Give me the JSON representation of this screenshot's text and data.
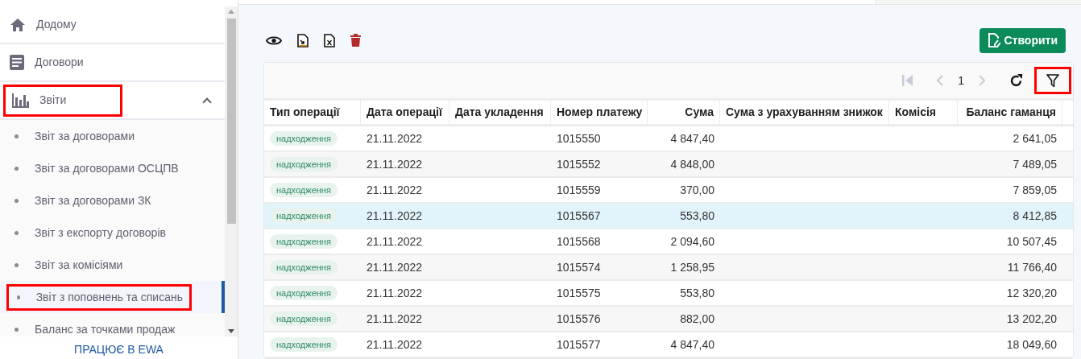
{
  "sidebar": {
    "items": [
      {
        "label": "Додому",
        "selected": false,
        "highlighted": false
      },
      {
        "label": "Договори",
        "selected": false,
        "highlighted": false
      },
      {
        "label": "Звіти",
        "selected": false,
        "highlighted": true,
        "expanded": true,
        "children": [
          {
            "label": "Звіт за договорами",
            "selected": false,
            "highlighted": false
          },
          {
            "label": "Звіт за договорами ОСЦПВ",
            "selected": false,
            "highlighted": false
          },
          {
            "label": "Звіт за договорами ЗК",
            "selected": false,
            "highlighted": false
          },
          {
            "label": "Звіт з експорту договорів",
            "selected": false,
            "highlighted": false
          },
          {
            "label": "Звіт за комісіями",
            "selected": false,
            "highlighted": false
          },
          {
            "label": "Звіт з поповнень та списань",
            "selected": true,
            "highlighted": true
          },
          {
            "label": "Баланс за точками продаж",
            "selected": false,
            "highlighted": false
          }
        ]
      }
    ],
    "footer": "ПРАЦЮЄ В EWA"
  },
  "toolbar": {
    "create_button": "Створити"
  },
  "pagination": {
    "page": "1",
    "filter_highlighted": true
  },
  "table": {
    "columns": [
      "Тип операції",
      "Дата операції",
      "Дата укладення",
      "Номер платежу",
      "Сума",
      "Сума з урахуванням знижок",
      "Комісія",
      "Баланс гаманця"
    ],
    "rows": [
      {
        "type": "надходження",
        "date": "21.11.2022",
        "number": "1015550",
        "sum": "4 847,40",
        "balance": "2 641,05",
        "selected": false
      },
      {
        "type": "надходження",
        "date": "21.11.2022",
        "number": "1015552",
        "sum": "4 848,00",
        "balance": "7 489,05",
        "selected": false
      },
      {
        "type": "надходження",
        "date": "21.11.2022",
        "number": "1015559",
        "sum": "370,00",
        "balance": "7 859,05",
        "selected": false
      },
      {
        "type": "надходження",
        "date": "21.11.2022",
        "number": "1015567",
        "sum": "553,80",
        "balance": "8 412,85",
        "selected": true
      },
      {
        "type": "надходження",
        "date": "21.11.2022",
        "number": "1015568",
        "sum": "2 094,60",
        "balance": "10 507,45",
        "selected": false
      },
      {
        "type": "надходження",
        "date": "21.11.2022",
        "number": "1015574",
        "sum": "1 258,95",
        "balance": "11 766,40",
        "selected": false
      },
      {
        "type": "надходження",
        "date": "21.11.2022",
        "number": "1015575",
        "sum": "553,80",
        "balance": "12 320,20",
        "selected": false
      },
      {
        "type": "надходження",
        "date": "21.11.2022",
        "number": "1015576",
        "sum": "882,00",
        "balance": "13 202,20",
        "selected": false
      },
      {
        "type": "надходження",
        "date": "21.11.2022",
        "number": "1015577",
        "sum": "4 847,40",
        "balance": "18 049,60",
        "selected": false
      }
    ]
  }
}
